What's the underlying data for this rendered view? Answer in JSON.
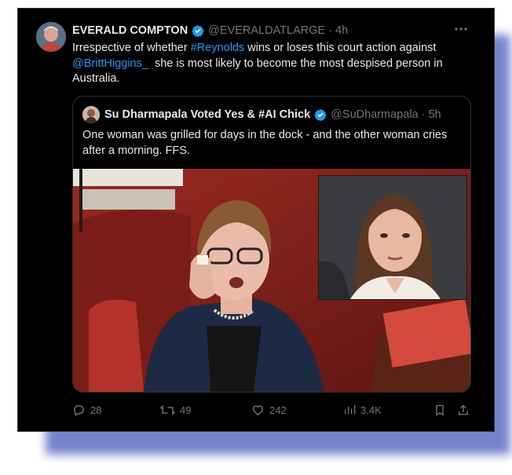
{
  "colors": {
    "accent": "#1d9bf0",
    "background": "#000000",
    "text": "#e7e9ea",
    "muted": "#71767b",
    "frame_shadow": "#5c6fc4"
  },
  "tweet": {
    "author_name": "EVERALD COMPTON",
    "handle": "@EVERALDATLARGE",
    "separator": "·",
    "time": "4h",
    "text_parts": {
      "p1": "Irrespective of whether ",
      "hashtag": "#Reynolds",
      "p2": " wins or loses this court action against ",
      "mention": "@BrittHiggins_",
      "p3": "  she is most likely to become the most despised person in Australia."
    }
  },
  "quote": {
    "author_name": "Su Dharmapala Voted Yes & #AI Chick",
    "handle": "@SuDharmapala",
    "separator": "·",
    "time": "5h",
    "text": "One woman was grilled for days in the dock - and the other woman cries after a morning. FFS."
  },
  "actions": {
    "replies": "28",
    "reposts": "49",
    "likes": "242",
    "views": "3.4K"
  },
  "icons": {
    "verified": "verified-badge-icon",
    "more": "more-options-icon",
    "reply": "reply-icon",
    "repost": "repost-icon",
    "like": "heart-icon",
    "views": "views-icon",
    "bookmark": "bookmark-icon",
    "share": "share-icon"
  }
}
